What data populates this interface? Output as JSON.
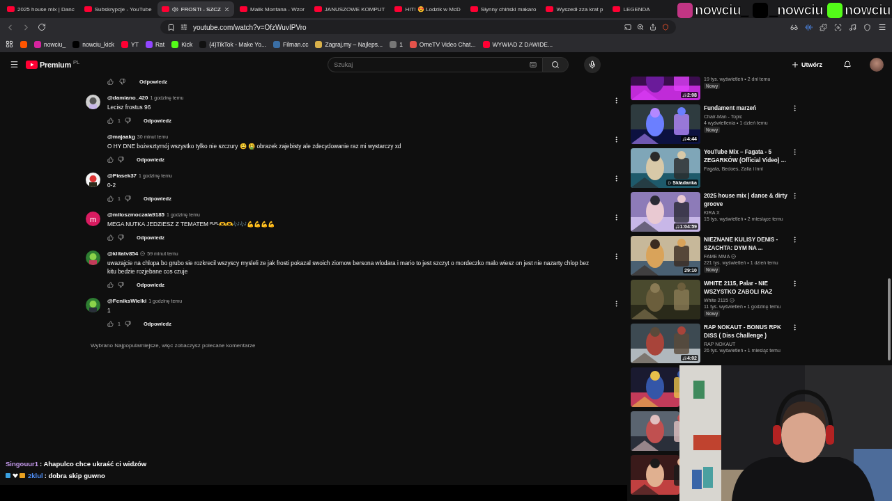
{
  "browser": {
    "tabs": [
      {
        "title": "2025 house mix | Danc",
        "selected": false,
        "audio": false
      },
      {
        "title": "Subskrypcje - YouTube",
        "selected": false,
        "audio": false
      },
      {
        "title": "FROSTI - SZCZ",
        "selected": true,
        "audio": true
      },
      {
        "title": "Malik Montana - Wzor",
        "selected": false,
        "audio": false
      },
      {
        "title": "JANUSZOWE KOMPUT",
        "selected": false,
        "audio": false
      },
      {
        "title": "HIT! 😍 Lodzik w McD",
        "selected": false,
        "audio": false
      },
      {
        "title": "Słynny chiński makaro",
        "selected": false,
        "audio": false
      },
      {
        "title": "Wyszedł zza krat p",
        "selected": false,
        "audio": false
      },
      {
        "title": "LEGENDA",
        "selected": false,
        "audio": false
      }
    ],
    "address": "youtube.com/watch?v=OfzWuvIPVro",
    "bookmarks": [
      {
        "kind": "icon"
      },
      {
        "kind": "link",
        "label": "nowciu_"
      },
      {
        "kind": "link",
        "label": "nowciu_kick"
      },
      {
        "kind": "link",
        "label": "YT"
      },
      {
        "kind": "link",
        "label": "Rat"
      },
      {
        "kind": "link",
        "label": "Kick"
      },
      {
        "kind": "link",
        "label": "(4)TikTok - Make Yo..."
      },
      {
        "kind": "link",
        "label": "Filman.cc"
      },
      {
        "kind": "link",
        "label": "Zagraj.my – Najleps..."
      },
      {
        "kind": "link",
        "label": "1"
      },
      {
        "kind": "link",
        "label": "OmeTV Video Chat..."
      },
      {
        "kind": "link",
        "label": "WYWIAD Z DAWIDE..."
      }
    ]
  },
  "socials": [
    {
      "kind": "instagram",
      "handle": "nowciu_"
    },
    {
      "kind": "x",
      "handle": "_nowciu"
    },
    {
      "kind": "kick",
      "handle": "nowciu"
    }
  ],
  "header": {
    "logo": "Premium",
    "region": "PL",
    "search_placeholder": "Szukaj",
    "create": "Utwórz"
  },
  "comments_top_actions": {
    "reply": "Odpowiedz"
  },
  "comments": [
    {
      "author": "@damiano_420",
      "verified": false,
      "time": "1 godzinę temu",
      "text": "Lecisz frostus 96",
      "likes": "1",
      "reply": "Odpowiedz"
    },
    {
      "author": "@majaakg",
      "verified": false,
      "time": "30 minut temu",
      "text": "O HY DNE bożesztymój wszystko tylko nie szczury 😫 🤮 obrazek zajebisty ale zdecydowanie raz mi wystarczy xd",
      "reply": "Odpowiedz",
      "avatar": {
        "kind": "blank"
      }
    },
    {
      "author": "@Piasek37",
      "verified": false,
      "time": "1 godzinę temu",
      "text": "0-2",
      "likes": "1",
      "reply": "Odpowiedz"
    },
    {
      "author": "@miloszmoczala9185",
      "verified": false,
      "time": "1 godzinę temu",
      "text": "MEGA NUTKA JEDZIESZ Z TEMATEM ᴾᴸᴾᴸ🫶🫶🎶🎶💪💪💪💪",
      "reply": "Odpowiedz",
      "avatar": {
        "kind": "letter",
        "letter": "m",
        "color": "#d81b60"
      }
    },
    {
      "author": "@klitatv854",
      "verified": true,
      "time": "59 minut temu",
      "text": "uwazajcie na chlopa bo grubo sie rozkrecil wszyscy mysleli ze jak frosti pokazal swoich ziomow bersona wlodara i mario to jest szczyt o mordeczko malo wiesz on jest nie nazarty chlop bez kitu bedzie rozjebane cos czuje",
      "reply": "Odpowiedz"
    },
    {
      "author": "@FeniksWielki",
      "verified": false,
      "time": "1 godzinę temu",
      "text": "1",
      "likes": "1",
      "reply": "Odpowiedz"
    }
  ],
  "comments_note": "Wybrano Najpopularniejsze, więc zobaczysz polecane komentarze",
  "videos": [
    {
      "kind": "cropped",
      "meta": "19 tys. wyświetleń • 2 dni temu",
      "badge": "Nowy",
      "duration": "2:08"
    },
    {
      "kind": "full",
      "title": "Fundament marzeń",
      "channel": "Chair-Man - Topic",
      "verified": false,
      "meta": "4 wyświetlenia • 1 dzień temu",
      "badge": "Nowy",
      "duration": "4:44"
    },
    {
      "kind": "full",
      "title": "YouTube Mix – Fagata - 5 ZEGARKÓW (Official Video) ...",
      "channel": "Fagata, Bedoes, Zalia i inni",
      "verified": false,
      "duration": "Składanka"
    },
    {
      "kind": "full",
      "title": "2025 house mix | dance & dirty groove",
      "channel": "KIRA X",
      "verified": false,
      "meta": "15 tys. wyświetleń • 2 miesiące temu",
      "duration": "1:04:59"
    },
    {
      "kind": "full",
      "title": "NIEZNANE KULISY DENIS - SZACHTA: DYM NA ...",
      "channel": "FAME MMA",
      "verified": true,
      "meta": "221 tys. wyświetleń • 1 dzień temu",
      "badge": "Nowy",
      "duration": "29:10"
    },
    {
      "kind": "full",
      "title": "WHITE 2115, Palar - NIE WSZYSTKO ZABOLI RAZ",
      "channel": "White 2115",
      "verified": true,
      "meta": "11 tys. wyświetleń • 1 godzinę temu",
      "badge": "Nowy"
    },
    {
      "kind": "full",
      "title": "RAP NOKAUT - BONUS RPK DISS ( Diss Challenge )",
      "channel": "RAP NOKAUT",
      "verified": false,
      "meta": "26 tys. wyświetleń • 1 miesiąc temu",
      "duration": "4:02"
    },
    {
      "kind": "thumb_only"
    },
    {
      "kind": "thumb_only"
    },
    {
      "kind": "thumb_only"
    }
  ],
  "chat": [
    {
      "badges": false,
      "user": "Singouur1",
      "color": "#c89cf0",
      "message": " : Ahapulco chce ukraść ci widzów"
    },
    {
      "badges": true,
      "user": "2klul",
      "color": "#4f8ff7",
      "message": " : dobra skip guwno"
    }
  ]
}
